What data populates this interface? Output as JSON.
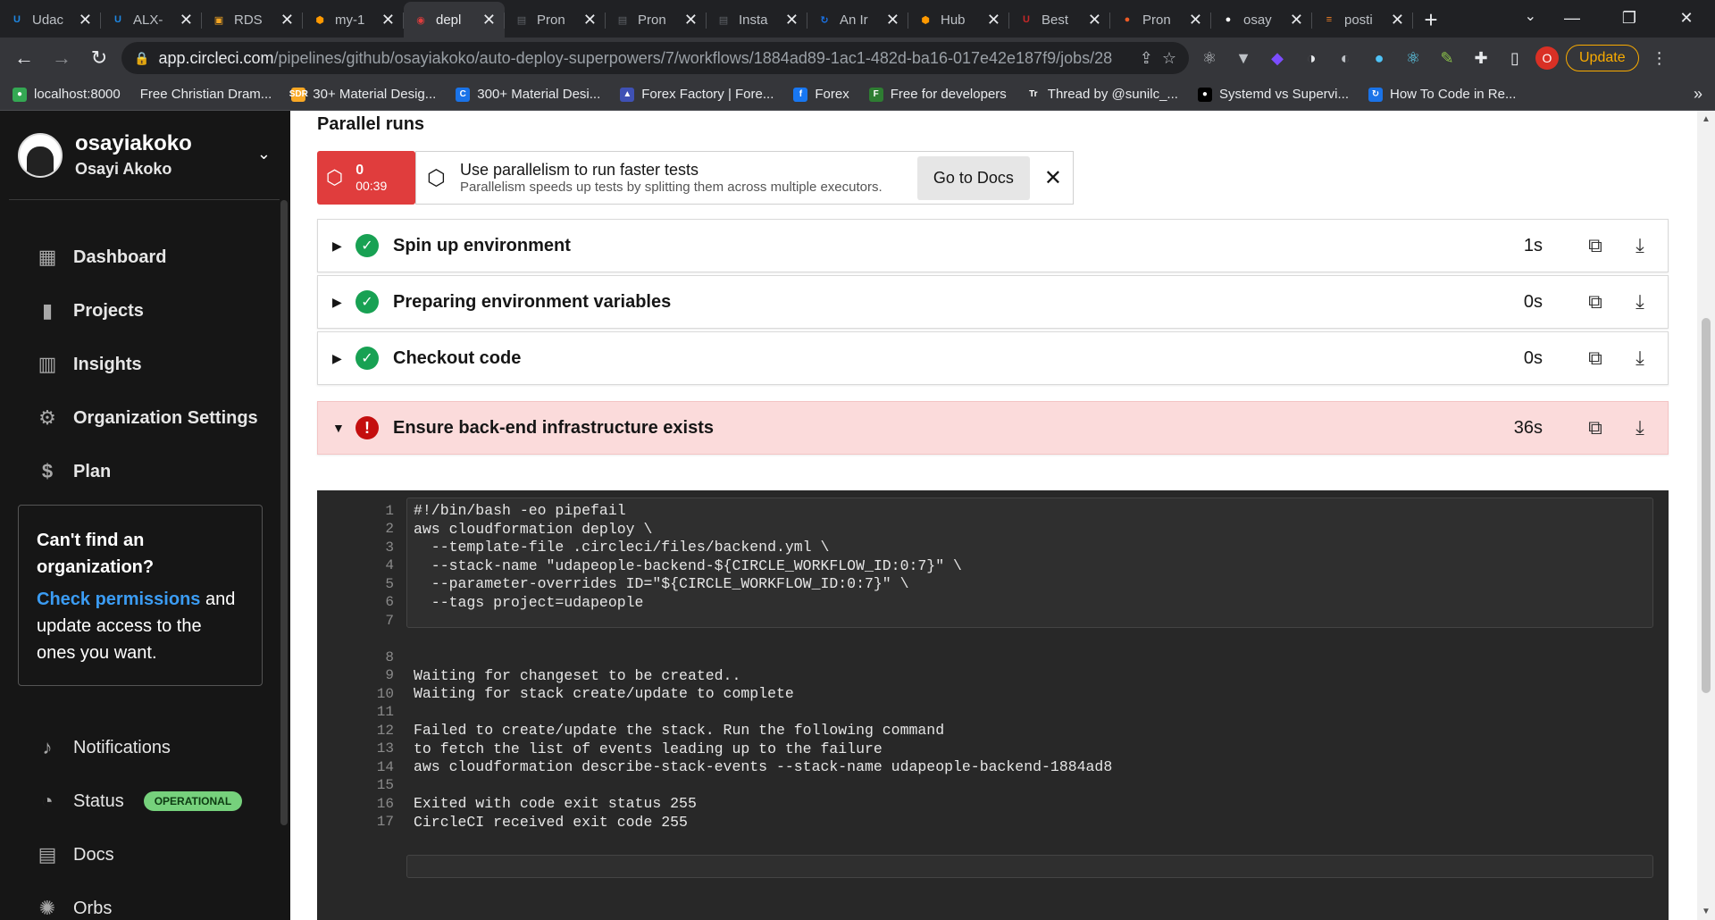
{
  "browser": {
    "tabs": [
      {
        "title": "Udac",
        "icon": "udacity-icon",
        "color": "#1e88e5",
        "glyph": "U"
      },
      {
        "title": "ALX-",
        "icon": "udacity-icon",
        "color": "#1e88e5",
        "glyph": "U"
      },
      {
        "title": "RDS",
        "icon": "box-icon",
        "color": "#f5a623",
        "glyph": "▣"
      },
      {
        "title": "my-1",
        "icon": "aws-icon",
        "color": "#ff9900",
        "glyph": "⬢"
      },
      {
        "title": "depl",
        "icon": "circleci-icon",
        "color": "#e03d3d",
        "glyph": "◉",
        "active": true
      },
      {
        "title": "Pron",
        "icon": "page-icon",
        "color": "#5f6368",
        "glyph": "▤"
      },
      {
        "title": "Pron",
        "icon": "page-icon",
        "color": "#5f6368",
        "glyph": "▤"
      },
      {
        "title": "Insta",
        "icon": "page-icon",
        "color": "#5f6368",
        "glyph": "▤"
      },
      {
        "title": "An Ir",
        "icon": "sync-icon",
        "color": "#1a73e8",
        "glyph": "↻"
      },
      {
        "title": "Hub",
        "icon": "aws-icon",
        "color": "#ff9900",
        "glyph": "⬢"
      },
      {
        "title": "Best",
        "icon": "usn-icon",
        "color": "#c62828",
        "glyph": "U"
      },
      {
        "title": "Pron",
        "icon": "postman-icon",
        "color": "#ef5b25",
        "glyph": "●"
      },
      {
        "title": "osay",
        "icon": "github-icon",
        "color": "#ffffff",
        "glyph": "●"
      },
      {
        "title": "posti",
        "icon": "stackoverflow-icon",
        "color": "#f48024",
        "glyph": "≡"
      }
    ],
    "url_host": "app.circleci.com",
    "url_path": "/pipelines/github/osayiakoko/auto-deploy-superpowers/7/workflows/1884ad89-1ac1-482d-ba16-017e42e187f9/jobs/28",
    "profile_letter": "O",
    "update_label": "Update",
    "bookmarks": [
      {
        "label": "localhost:8000",
        "color": "#34a853",
        "glyph": "●"
      },
      {
        "label": "Free Christian Dram...",
        "color": "#35363a",
        "glyph": ""
      },
      {
        "label": "30+ Material Desig...",
        "color": "#f9a825",
        "glyph": "SDR"
      },
      {
        "label": "300+ Material Desi...",
        "color": "#1a73e8",
        "glyph": "C"
      },
      {
        "label": "Forex Factory | Fore...",
        "color": "#3f51b5",
        "glyph": "▲"
      },
      {
        "label": "Forex",
        "color": "#1877f2",
        "glyph": "f"
      },
      {
        "label": "Free for developers",
        "color": "#2e7d32",
        "glyph": "F"
      },
      {
        "label": "Thread by @sunilc_...",
        "color": "#35363a",
        "glyph": "Tr"
      },
      {
        "label": "Systemd vs Supervi...",
        "color": "#000000",
        "glyph": "●"
      },
      {
        "label": "How To Code in Re...",
        "color": "#1a73e8",
        "glyph": "↻"
      }
    ]
  },
  "sidebar": {
    "org_name": "osayiakoko",
    "user_name": "Osayi Akoko",
    "items": [
      {
        "label": "Dashboard",
        "icon": "dashboard-icon",
        "glyph": "▦"
      },
      {
        "label": "Projects",
        "icon": "projects-icon",
        "glyph": "▮"
      },
      {
        "label": "Insights",
        "icon": "insights-icon",
        "glyph": "▥"
      },
      {
        "label": "Organization Settings",
        "icon": "gear-icon",
        "glyph": "⚙"
      },
      {
        "label": "Plan",
        "icon": "dollar-icon",
        "glyph": "$"
      }
    ],
    "cantfind": {
      "heading": "Can't find an organization?",
      "link": "Check permissions",
      "rest": " and update access to the ones you want."
    },
    "bottom_items": [
      {
        "label": "Notifications",
        "icon": "bell-icon",
        "glyph": "🔔"
      },
      {
        "label": "Status",
        "icon": "status-icon",
        "glyph": "◔",
        "badge": "OPERATIONAL"
      },
      {
        "label": "Docs",
        "icon": "docs-icon",
        "glyph": "▤"
      },
      {
        "label": "Orbs",
        "icon": "orbs-icon",
        "glyph": "✺"
      }
    ]
  },
  "main": {
    "parallel_title": "Parallel runs",
    "parallel_index": "0",
    "parallel_time": "00:39",
    "banner_title": "Use parallelism to run faster tests",
    "banner_sub": "Parallelism speeds up tests by splitting them across multiple executors.",
    "docs_button": "Go to Docs",
    "steps": [
      {
        "name": "Spin up environment",
        "duration": "1s",
        "status": "success"
      },
      {
        "name": "Preparing environment variables",
        "duration": "0s",
        "status": "success"
      },
      {
        "name": "Checkout code",
        "duration": "0s",
        "status": "success"
      },
      {
        "name": "Ensure back-end infrastructure exists",
        "duration": "36s",
        "status": "failed"
      }
    ],
    "log_lines": [
      {
        "n": "1",
        "text": "#!/bin/bash -eo pipefail"
      },
      {
        "n": "2",
        "text": "aws cloudformation deploy \\"
      },
      {
        "n": "3",
        "text": "  --template-file .circleci/files/backend.yml \\"
      },
      {
        "n": "4",
        "text": "  --stack-name \"udapeople-backend-${CIRCLE_WORKFLOW_ID:0:7}\" \\"
      },
      {
        "n": "5",
        "text": "  --parameter-overrides ID=\"${CIRCLE_WORKFLOW_ID:0:7}\" \\"
      },
      {
        "n": "6",
        "text": "  --tags project=udapeople"
      },
      {
        "n": "7",
        "text": ""
      },
      {
        "n": "8",
        "text": ""
      },
      {
        "n": "9",
        "text": "Waiting for changeset to be created.."
      },
      {
        "n": "10",
        "text": "Waiting for stack create/update to complete"
      },
      {
        "n": "11",
        "text": ""
      },
      {
        "n": "12",
        "text": "Failed to create/update the stack. Run the following command"
      },
      {
        "n": "13",
        "text": "to fetch the list of events leading up to the failure"
      },
      {
        "n": "14",
        "text": "aws cloudformation describe-stack-events --stack-name udapeople-backend-1884ad8"
      },
      {
        "n": "15",
        "text": ""
      },
      {
        "n": "16",
        "text": "Exited with code exit status 255"
      },
      {
        "n": "17",
        "text": "CircleCI received exit code 255"
      }
    ]
  }
}
